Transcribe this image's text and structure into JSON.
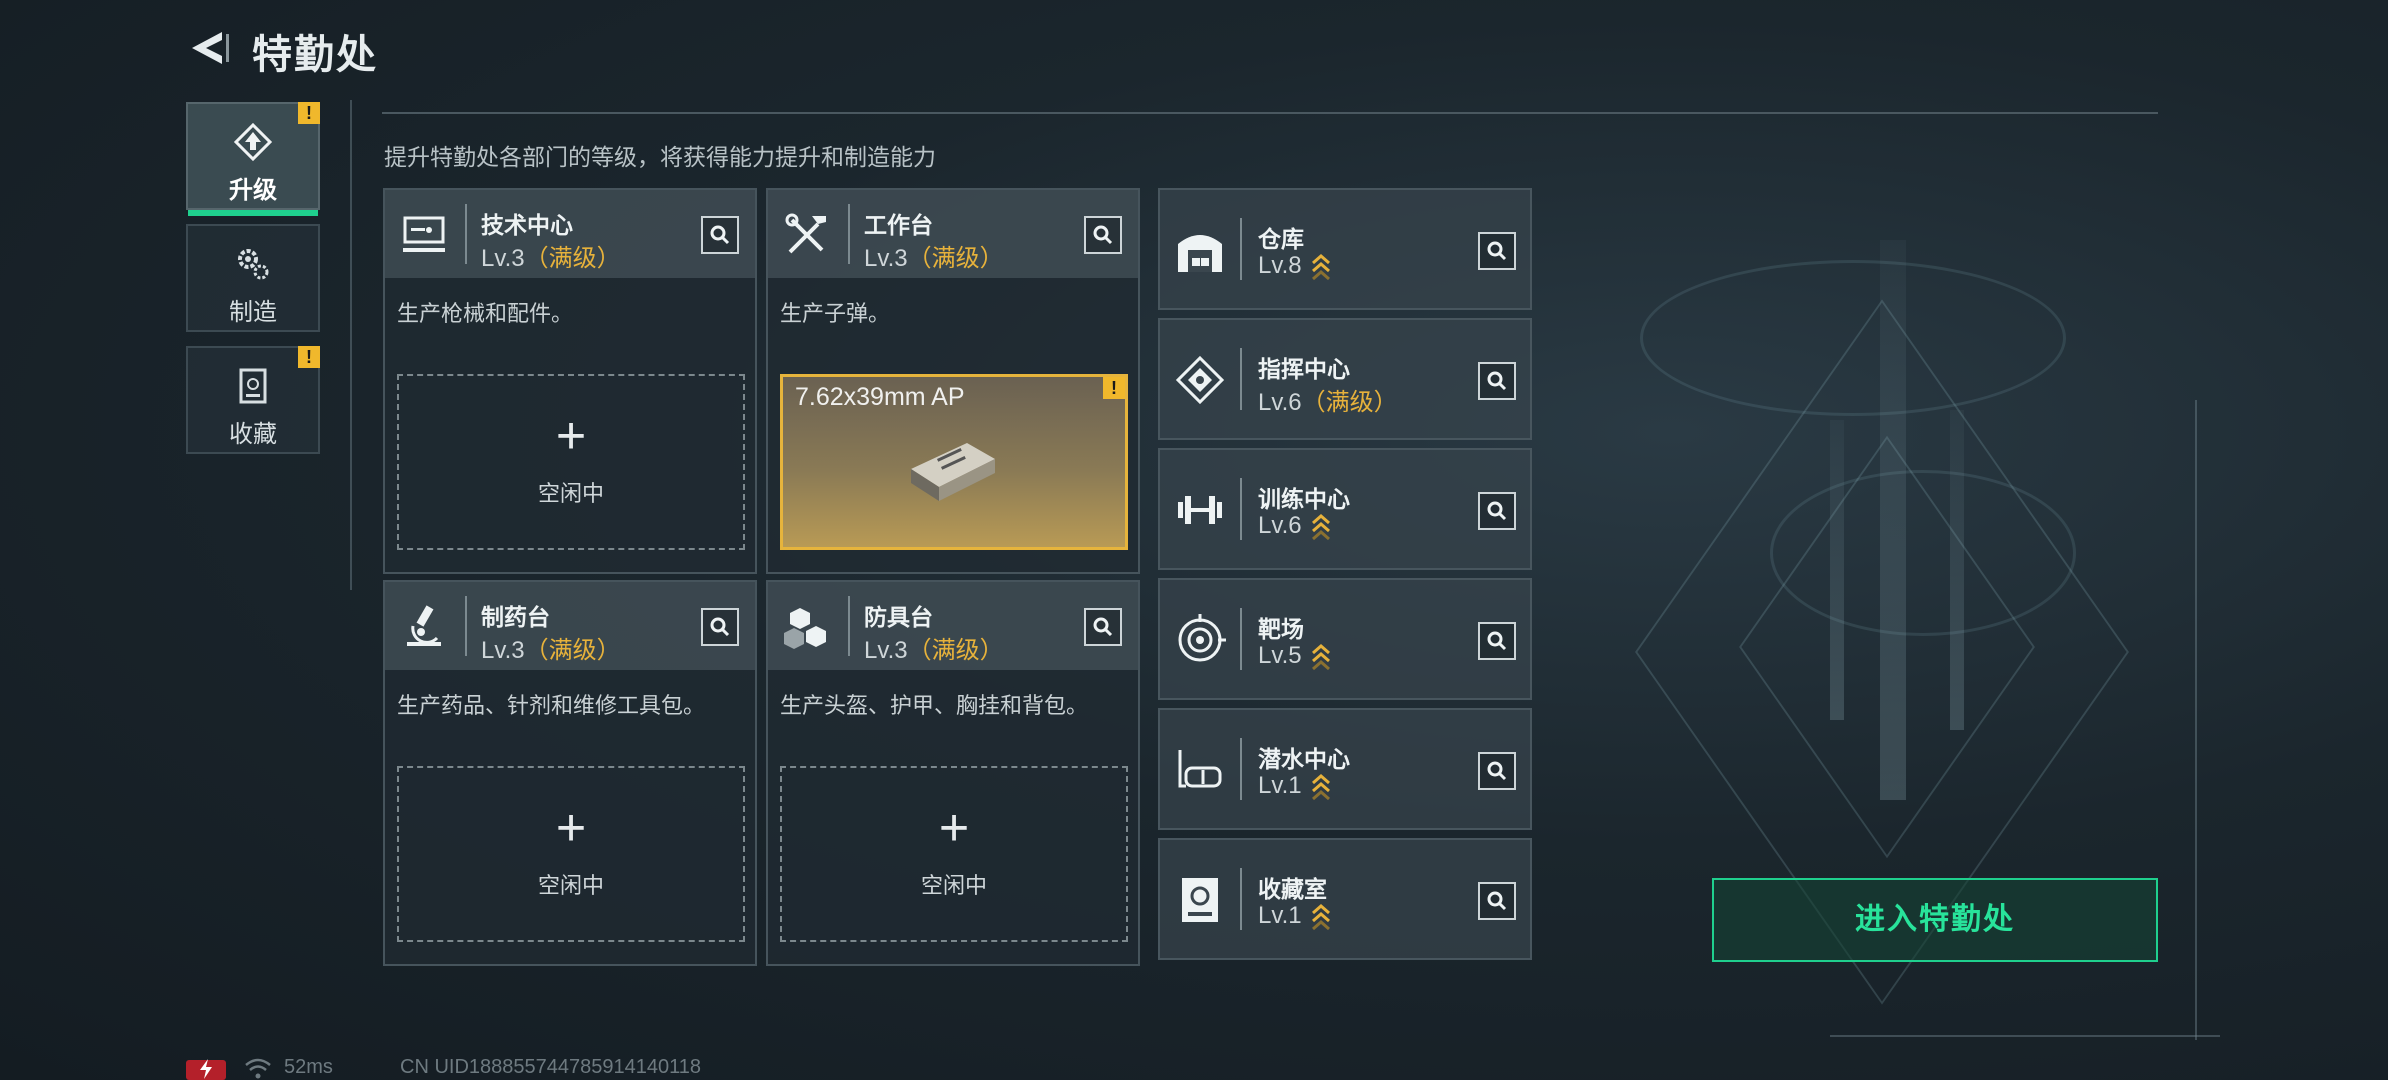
{
  "header": {
    "title": "特勤处"
  },
  "nav": [
    {
      "label": "升级",
      "icon": "upgrade-icon",
      "active": true,
      "alert": "!"
    },
    {
      "label": "制造",
      "icon": "craft-gears-icon",
      "active": false,
      "alert": ""
    },
    {
      "label": "收藏",
      "icon": "collection-cabinet-icon",
      "active": false,
      "alert": "!"
    }
  ],
  "subtitle": "提升特勤处各部门的等级，将获得能力提升和制造能力",
  "departments": [
    {
      "name": "技术中心",
      "level": "Lv.3",
      "max": "（满级）",
      "icon": "computer-icon",
      "desc": "生产枪械和配件。",
      "slot": {
        "plus": "+",
        "label": "空闲中"
      }
    },
    {
      "name": "工作台",
      "level": "Lv.3",
      "max": "（满级）",
      "icon": "tools-icon",
      "desc": "生产子弹。",
      "slot": {
        "item": "7.62x39mm AP",
        "alert": "!"
      }
    },
    {
      "name": "制药台",
      "level": "Lv.3",
      "max": "（满级）",
      "icon": "microscope-icon",
      "desc": "生产药品、针剂和维修工具包。",
      "slot": {
        "plus": "+",
        "label": "空闲中"
      }
    },
    {
      "name": "防具台",
      "level": "Lv.3",
      "max": "（满级）",
      "icon": "armor-boxes-icon",
      "desc": "生产头盔、护甲、胸挂和背包。",
      "slot": {
        "plus": "+",
        "label": "空闲中"
      }
    }
  ],
  "facilities": [
    {
      "name": "仓库",
      "level": "Lv.8",
      "max": "",
      "icon": "warehouse-icon"
    },
    {
      "name": "指挥中心",
      "level": "Lv.6",
      "max": "（满级）",
      "icon": "command-icon"
    },
    {
      "name": "训练中心",
      "level": "Lv.6",
      "max": "",
      "icon": "dumbbell-icon"
    },
    {
      "name": "靶场",
      "level": "Lv.5",
      "max": "",
      "icon": "target-icon"
    },
    {
      "name": "潜水中心",
      "level": "Lv.1",
      "max": "",
      "icon": "diving-mask-icon"
    },
    {
      "name": "收藏室",
      "level": "Lv.1",
      "max": "",
      "icon": "vault-icon"
    }
  ],
  "enter_button": "进入特勤处",
  "status": {
    "ping": "52ms",
    "uid": "CN UID1888557447859141401​18"
  },
  "colors": {
    "accent": "#1fd08e",
    "gold": "#e7b23b",
    "alert": "#f0b82c",
    "battery": "#b4202a"
  }
}
